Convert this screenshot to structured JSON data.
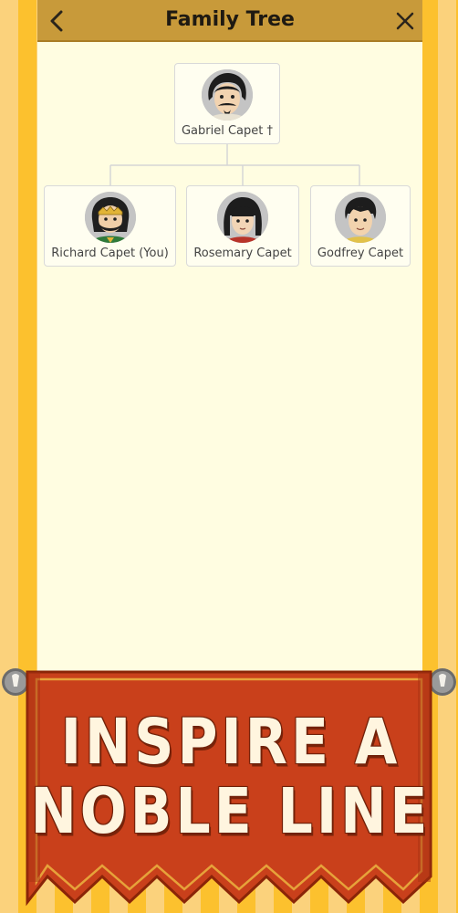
{
  "header": {
    "title": "Family Tree",
    "back_icon": "chevron-left-icon",
    "close_icon": "close-icon"
  },
  "tree": {
    "parent": {
      "name": "Gabriel Capet †",
      "deceased": true
    },
    "children": [
      {
        "name": "Richard Capet (You)"
      },
      {
        "name": "Rosemary Capet"
      },
      {
        "name": "Godfrey Capet"
      }
    ]
  },
  "banner": {
    "line1": "INSPIRE A",
    "line2": "NOBLE LINE"
  },
  "colors": {
    "header_bg": "#c89a3a",
    "panel_bg": "#fffde1",
    "banner_red": "#c9401b",
    "stripe_light": "#fbd27c",
    "stripe_dark": "#fcc12e"
  }
}
